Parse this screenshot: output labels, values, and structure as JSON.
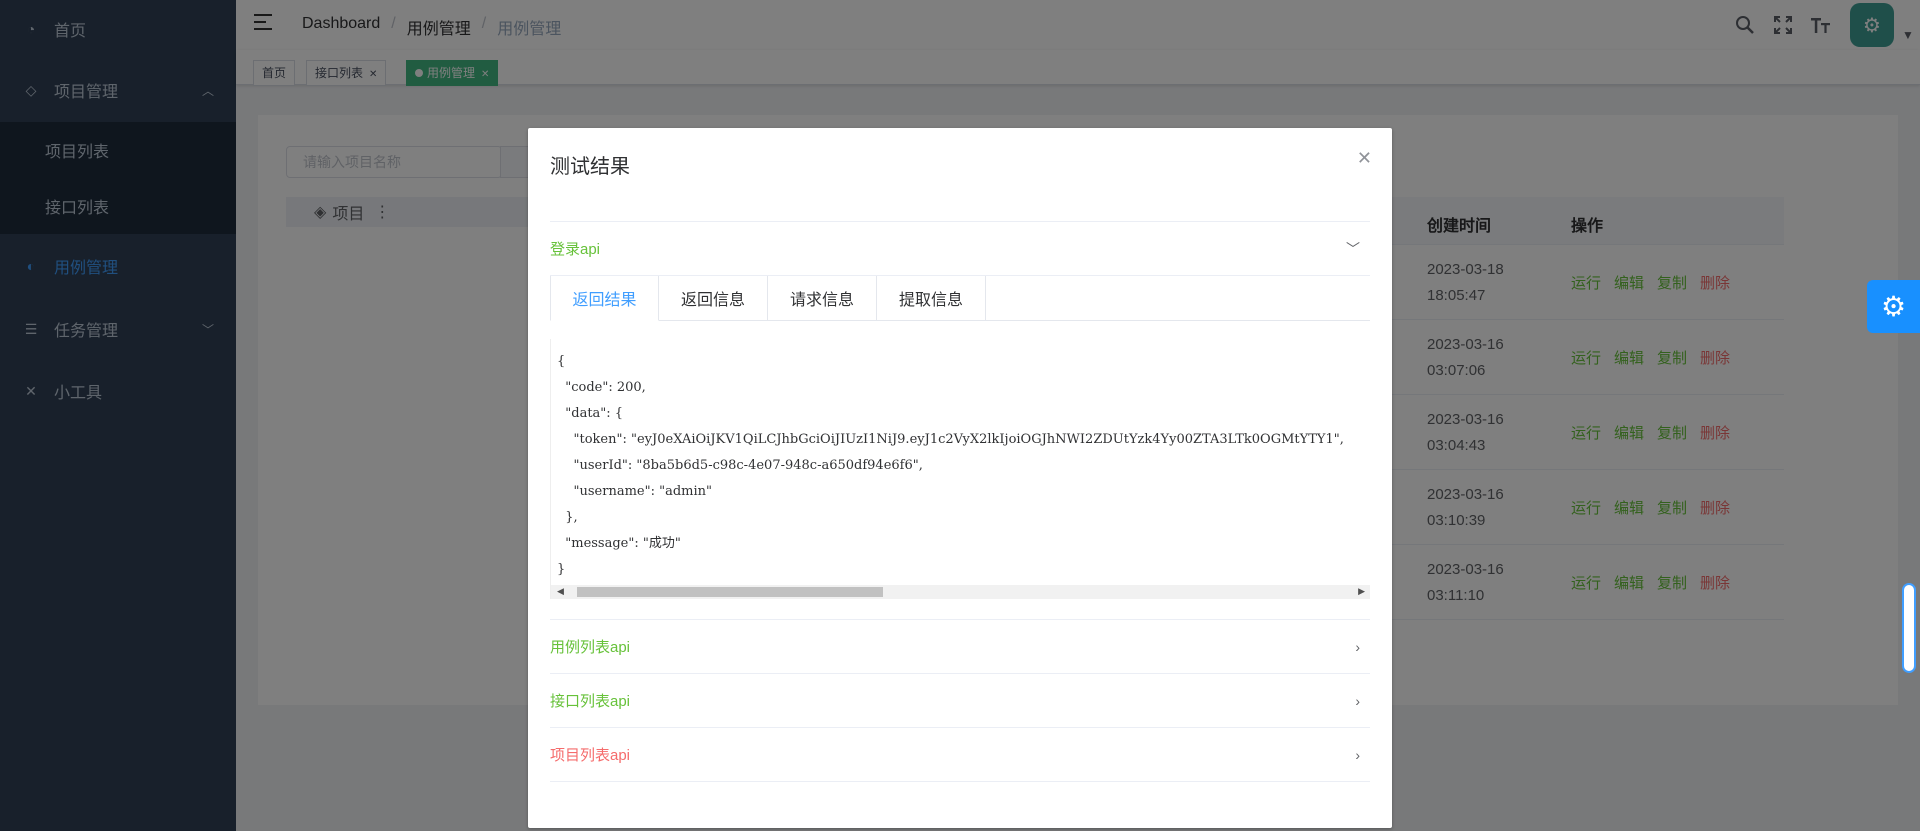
{
  "sidebar": {
    "items": [
      {
        "label": "首页",
        "icon": "dashboard-icon"
      },
      {
        "label": "项目管理",
        "icon": "layers-icon",
        "expanded": true,
        "children": [
          {
            "label": "项目列表"
          },
          {
            "label": "接口列表"
          }
        ]
      },
      {
        "label": "用例管理",
        "icon": "pie-chart-icon",
        "active": true
      },
      {
        "label": "任务管理",
        "icon": "list-icon",
        "expanded": false
      },
      {
        "label": "小工具",
        "icon": "tools-icon"
      }
    ]
  },
  "header": {
    "breadcrumb": [
      "Dashboard",
      "用例管理",
      "用例管理"
    ],
    "icons": [
      "search-icon",
      "fullscreen-icon",
      "font-size-icon"
    ]
  },
  "tags": [
    {
      "label": "首页",
      "active": false,
      "closable": false
    },
    {
      "label": "接口列表",
      "active": false,
      "closable": true
    },
    {
      "label": "用例管理",
      "active": true,
      "closable": true
    }
  ],
  "page": {
    "search_placeholder": "请输入项目名称",
    "tree_header": "项目",
    "table": {
      "columns": [
        "创建时间",
        "操作"
      ],
      "rows": [
        {
          "time": "2023-03-18 18:05:47"
        },
        {
          "time": "2023-03-16 03:07:06"
        },
        {
          "time": "2023-03-16 03:04:43"
        },
        {
          "time": "2023-03-16 03:10:39"
        },
        {
          "time": "2023-03-16 03:11:10"
        }
      ],
      "actions": [
        "运行",
        "编辑",
        "复制",
        "删除"
      ]
    }
  },
  "dialog": {
    "title": "测试结果",
    "sections": [
      {
        "title": "登录api",
        "status": "success",
        "expanded": true
      },
      {
        "title": "用例列表api",
        "status": "success",
        "expanded": false
      },
      {
        "title": "接口列表api",
        "status": "success",
        "expanded": false
      },
      {
        "title": "项目列表api",
        "status": "fail",
        "expanded": false
      }
    ],
    "tabs": [
      "返回结果",
      "返回信息",
      "请求信息",
      "提取信息"
    ],
    "active_tab": "返回结果",
    "response_code": "{\n  \"code\": 200,\n  \"data\": {\n    \"token\": \"eyJ0eXAiOiJKV1QiLCJhbGciOiJIUzI1NiJ9.eyJ1c2VyX2lkIjoiOGJhNWI2ZDUtYzk4Yy00ZTA3LTk0OGMtYTY1\",\n    \"userId\": \"8ba5b6d5-c98c-4e07-948c-a650df94e6f6\",\n    \"username\": \"admin\"\n  },\n  \"message\": \"成功\"\n}"
  },
  "colors": {
    "sidebar_bg": "#304156",
    "active_menu": "#409eff",
    "tag_active": "#42b983",
    "success": "#67c23a",
    "danger": "#f56c6c",
    "settings_btn": "#1890ff"
  }
}
